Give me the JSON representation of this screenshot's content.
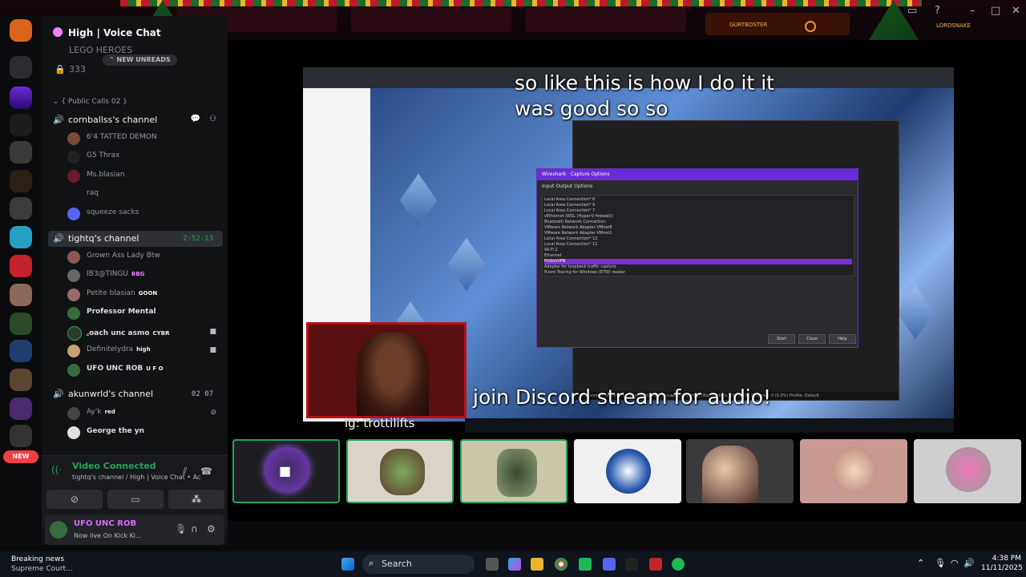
{
  "server": {
    "title": "High | Voice Chat"
  },
  "sidebar_hidden": {
    "row1": "LEGO HEROES",
    "row2": "333"
  },
  "unreads_label": "NEW UNREADS",
  "category": "{ Public Calls 02 }",
  "channels": [
    {
      "name": "cornballss's channel",
      "members": [
        {
          "name": "6'4 TATTED DEMON"
        },
        {
          "name": "G5 Thrax"
        },
        {
          "name": "Ms.blasian"
        },
        {
          "name": "raq"
        },
        {
          "name": "squeeze sacks"
        }
      ]
    },
    {
      "name": "tightq's channel",
      "timer": "2:52:13",
      "members": [
        {
          "name": "Grown Ass Lady Btw"
        },
        {
          "name": "IB3@TINGU",
          "badge": "BBG"
        },
        {
          "name": "Petite blasian",
          "badge": "GOON"
        },
        {
          "name": "Professor Mental"
        },
        {
          "name": "꜀oach unc asmo",
          "badge": "CYBR"
        },
        {
          "name": "Definitelydra",
          "badge": "high"
        },
        {
          "name": "UFO UNC ROB",
          "badge": "U F O"
        }
      ]
    },
    {
      "name": "akunwrld's channel",
      "timer": "02  07",
      "members": [
        {
          "name": "Ay'k",
          "badge": "red"
        },
        {
          "name": "George the yn"
        }
      ]
    }
  ],
  "new_badge": "NEW",
  "connection": {
    "title": "Video Connected",
    "subtitle": "tightq's channel / High | Voice Chat • Activ..."
  },
  "user": {
    "name": "UFO UNC ROB",
    "status": "Now live On Kick Ki..."
  },
  "stream": {
    "caption_top_1": "so like this is how I do it it",
    "caption_top_2": "was good so so",
    "caption_bottom": "join Discord stream for audio!",
    "cam_label": "ig: trottilifts",
    "dialog_title": "Wireshark · Capture Options",
    "dialog_tabs": "Input   Output   Options",
    "rows": [
      "Local Area Connection* 8",
      "Local Area Connection* 9",
      "Local Area Connection* 7",
      "vEthernet (WSL (Hyper-V firewall))",
      "Bluetooth Network Connection",
      "VMware Network Adapter VMnet8",
      "VMware Network Adapter VMnet1",
      "Local Area Connection* 12",
      "Local Area Connection* 11",
      "Wi-Fi 2",
      "Ethernet",
      "ProtonVPN",
      "Adapter for loopback traffic capture",
      "Event Tracing for Windows (ETW) reader"
    ],
    "selected_row": 11,
    "buttons": [
      "Start",
      "Close",
      "Help"
    ],
    "status": "Rescanning: wireshark_ProtonVPN2GBSF3.pcapng   Resetting filter   Packets: 2861963 · Dropped: 0 (0.0%)   Profile: Default"
  },
  "taskbar": {
    "search": "Search",
    "time": "4:38 PM",
    "date": "11/11/2025",
    "news_title": "Breaking news",
    "news_sub": "Supreme Court..."
  },
  "banner": {
    "text": "GURTBOSTER",
    "user_tag": "LORDSNAKE"
  },
  "colors": {
    "accent_green": "#23a55a",
    "discord_blurple": "#5865f2",
    "wireshark_purple": "#7a2fd1"
  }
}
